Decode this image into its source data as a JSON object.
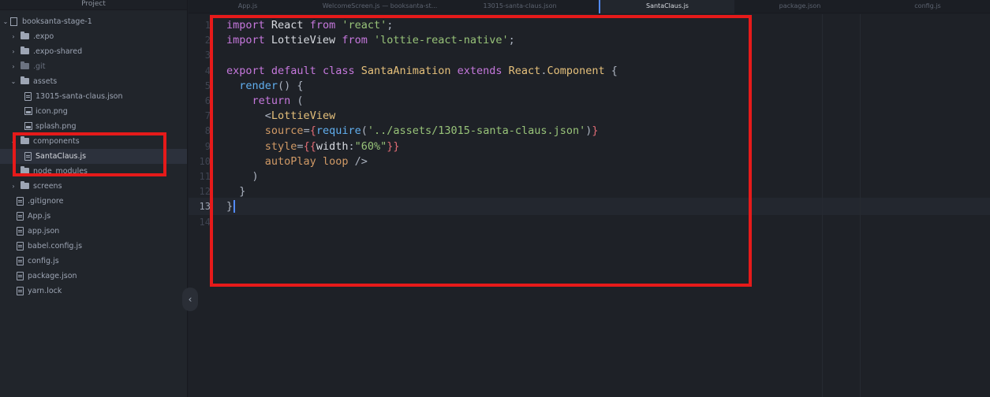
{
  "sidebar": {
    "title": "Project",
    "root": "booksanta-stage-1",
    "items": [
      {
        "label": ".expo",
        "type": "folder",
        "arrow": ">"
      },
      {
        "label": ".expo-shared",
        "type": "folder",
        "arrow": ">"
      },
      {
        "label": ".git",
        "type": "folder",
        "arrow": ">"
      },
      {
        "label": "assets",
        "type": "folder",
        "arrow": "v"
      },
      {
        "label": "13015-santa-claus.json",
        "type": "file"
      },
      {
        "label": "icon.png",
        "type": "image"
      },
      {
        "label": "splash.png",
        "type": "image"
      },
      {
        "label": "components",
        "type": "folder",
        "arrow": "v"
      },
      {
        "label": "SantaClaus.js",
        "type": "file"
      },
      {
        "label": "node_modules",
        "type": "folder",
        "arrow": ">"
      },
      {
        "label": "screens",
        "type": "folder",
        "arrow": ">"
      },
      {
        "label": ".gitignore",
        "type": "file"
      },
      {
        "label": "App.js",
        "type": "file"
      },
      {
        "label": "app.json",
        "type": "file"
      },
      {
        "label": "babel.config.js",
        "type": "file"
      },
      {
        "label": "config.js",
        "type": "file"
      },
      {
        "label": "package.json",
        "type": "file"
      },
      {
        "label": "yarn.lock",
        "type": "file"
      }
    ],
    "collapse_glyph": "‹"
  },
  "tabs": [
    {
      "label": "App.js"
    },
    {
      "label": "WelcomeScreen.js — booksanta-st..."
    },
    {
      "label": "13015-santa-claus.json"
    },
    {
      "label": "SantaClaus.js",
      "active": true
    },
    {
      "label": "package.json"
    },
    {
      "label": "config.js"
    }
  ],
  "editor": {
    "current_line": 13,
    "line_numbers": [
      "1",
      "2",
      "3",
      "4",
      "5",
      "6",
      "7",
      "8",
      "9",
      "10",
      "11",
      "12",
      "13",
      "14"
    ],
    "lines": [
      [
        {
          "t": "import ",
          "c": "kw"
        },
        {
          "t": "React ",
          "c": "plain"
        },
        {
          "t": "from ",
          "c": "kw"
        },
        {
          "t": "'react'",
          "c": "str"
        },
        {
          "t": ";",
          "c": "punc"
        }
      ],
      [
        {
          "t": "import ",
          "c": "kw"
        },
        {
          "t": "LottieView ",
          "c": "plain"
        },
        {
          "t": "from ",
          "c": "kw"
        },
        {
          "t": "'lottie-react-native'",
          "c": "str"
        },
        {
          "t": ";",
          "c": "punc"
        }
      ],
      [],
      [
        {
          "t": "export ",
          "c": "kw"
        },
        {
          "t": "default ",
          "c": "kw"
        },
        {
          "t": "class ",
          "c": "kw"
        },
        {
          "t": "SantaAnimation ",
          "c": "cls"
        },
        {
          "t": "extends ",
          "c": "kw"
        },
        {
          "t": "React",
          "c": "cls"
        },
        {
          "t": ".",
          "c": "punc"
        },
        {
          "t": "Component ",
          "c": "cls"
        },
        {
          "t": "{",
          "c": "punc"
        }
      ],
      [
        {
          "t": "  ",
          "c": "plain"
        },
        {
          "t": "render",
          "c": "fn"
        },
        {
          "t": "() {",
          "c": "punc"
        }
      ],
      [
        {
          "t": "    ",
          "c": "plain"
        },
        {
          "t": "return ",
          "c": "kw"
        },
        {
          "t": "(",
          "c": "punc"
        }
      ],
      [
        {
          "t": "      ",
          "c": "plain"
        },
        {
          "t": "<",
          "c": "punc"
        },
        {
          "t": "LottieView",
          "c": "tag"
        }
      ],
      [
        {
          "t": "      ",
          "c": "plain"
        },
        {
          "t": "source",
          "c": "attr"
        },
        {
          "t": "=",
          "c": "punc"
        },
        {
          "t": "{",
          "c": "brace"
        },
        {
          "t": "require",
          "c": "fn"
        },
        {
          "t": "(",
          "c": "punc"
        },
        {
          "t": "'../assets/13015-santa-claus.json'",
          "c": "str"
        },
        {
          "t": ")",
          "c": "punc"
        },
        {
          "t": "}",
          "c": "brace"
        }
      ],
      [
        {
          "t": "      ",
          "c": "plain"
        },
        {
          "t": "style",
          "c": "attr"
        },
        {
          "t": "=",
          "c": "punc"
        },
        {
          "t": "{{",
          "c": "brace"
        },
        {
          "t": "width",
          "c": "plain"
        },
        {
          "t": ":",
          "c": "punc"
        },
        {
          "t": "\"60%\"",
          "c": "str"
        },
        {
          "t": "}}",
          "c": "brace"
        }
      ],
      [
        {
          "t": "      ",
          "c": "plain"
        },
        {
          "t": "autoPlay ",
          "c": "attr"
        },
        {
          "t": "loop ",
          "c": "attr"
        },
        {
          "t": "/>",
          "c": "punc"
        }
      ],
      [
        {
          "t": "    ",
          "c": "plain"
        },
        {
          "t": ")",
          "c": "punc"
        }
      ],
      [
        {
          "t": "  ",
          "c": "plain"
        },
        {
          "t": "}",
          "c": "punc"
        }
      ],
      [
        {
          "t": "}",
          "c": "punc"
        }
      ],
      []
    ]
  }
}
